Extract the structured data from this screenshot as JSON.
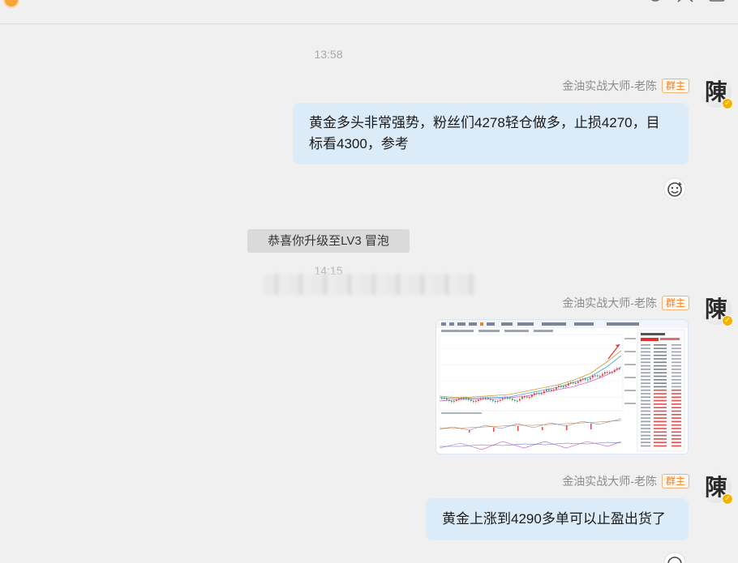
{
  "header": {
    "icons": [
      "coin-icon",
      "gear-icon",
      "contacts-icon",
      "window-icon"
    ]
  },
  "messages": {
    "ts1": "13:58",
    "msg1": {
      "sender": "金油实战大师-老陈",
      "role": "群主",
      "text_line1": "黄金多头非常强势，粉丝们4278轻仓做多，止损4270，目",
      "text_line2": "标看4300，参考"
    },
    "system_tip": "恭喜你升级至LV3 冒泡",
    "ts2": "14:15",
    "msg2": {
      "sender": "金油实战大师-老陈",
      "role": "群主",
      "image": "chart-screenshot"
    },
    "msg3": {
      "sender": "金油实战大师-老陈",
      "role": "群主",
      "text": "黄金上涨到4290多单可以止盈出货了"
    }
  },
  "avatar_glyph": "陳",
  "colors": {
    "bubble": "#dcebf8",
    "role_tag": "#e9822d",
    "background": "#f0f0f0"
  }
}
